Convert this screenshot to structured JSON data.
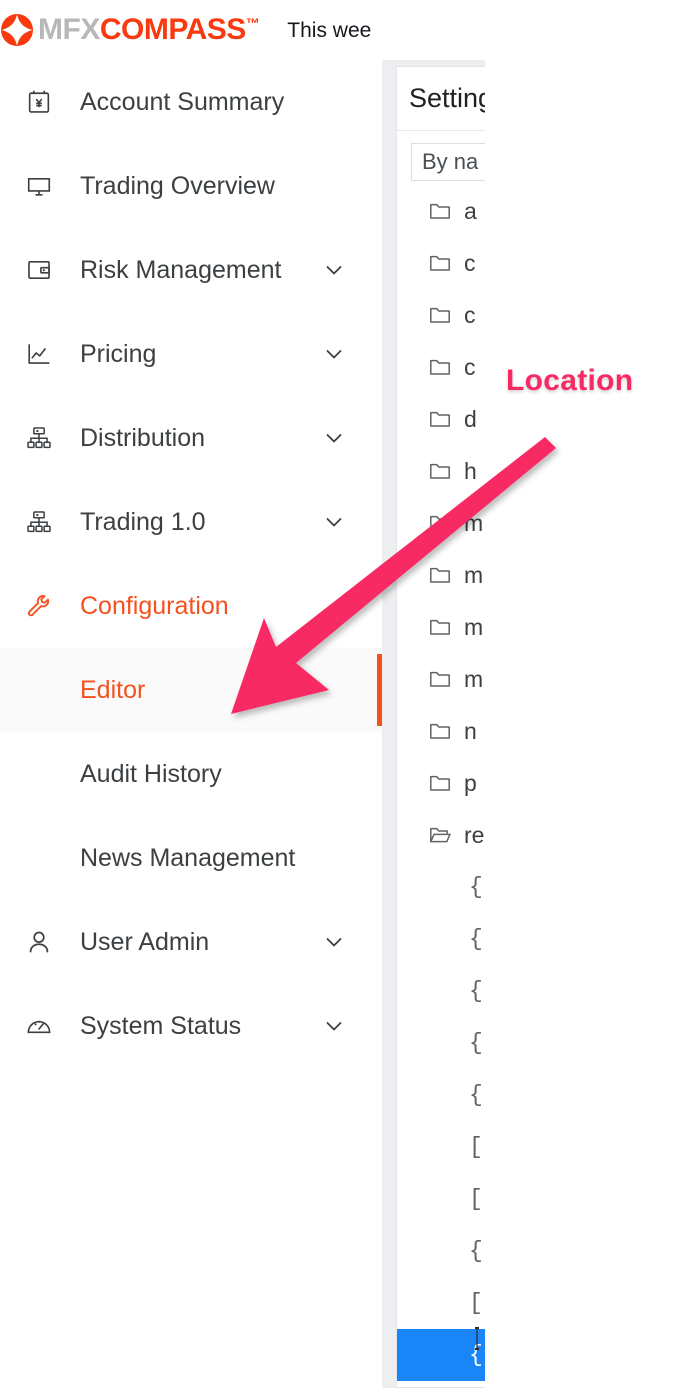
{
  "header": {
    "logo_mark": "diamond-star-icon",
    "logo_text_primary": "MFX",
    "logo_text_secondary": "COMPASS",
    "logo_trademark": "™",
    "note_text": "This wee",
    "brand_gray": "#b8b8b8",
    "brand_orange": "#f93a0f"
  },
  "sidebar": {
    "items": [
      {
        "label": "Account Summary",
        "icon": "calendar-yen-icon",
        "has_chevron": false,
        "level": 0,
        "state": "default"
      },
      {
        "label": "Trading Overview",
        "icon": "monitor-icon",
        "has_chevron": false,
        "level": 0,
        "state": "default"
      },
      {
        "label": "Risk Management",
        "icon": "wallet-icon",
        "has_chevron": true,
        "level": 0,
        "state": "default"
      },
      {
        "label": "Pricing",
        "icon": "line-chart-icon",
        "has_chevron": true,
        "level": 0,
        "state": "default"
      },
      {
        "label": "Distribution",
        "icon": "sitemap-icon",
        "has_chevron": true,
        "level": 0,
        "state": "default"
      },
      {
        "label": "Trading 1.0",
        "icon": "sitemap-icon",
        "has_chevron": true,
        "level": 0,
        "state": "default"
      },
      {
        "label": "Configuration",
        "icon": "wrench-icon",
        "has_chevron": false,
        "level": 0,
        "state": "accent"
      },
      {
        "label": "Editor",
        "icon": "none",
        "has_chevron": false,
        "level": 1,
        "state": "active"
      },
      {
        "label": "Audit History",
        "icon": "none",
        "has_chevron": false,
        "level": 1,
        "state": "default"
      },
      {
        "label": "News Management",
        "icon": "none",
        "has_chevron": false,
        "level": 1,
        "state": "default"
      },
      {
        "label": "User Admin",
        "icon": "person-icon",
        "has_chevron": true,
        "level": 0,
        "state": "default"
      },
      {
        "label": "System Status",
        "icon": "gauge-icon",
        "has_chevron": true,
        "level": 0,
        "state": "default"
      }
    ],
    "active_accent_color": "#f4511e",
    "active_row_background": "#fafafa"
  },
  "panel": {
    "title": "Setting",
    "search": {
      "value": "By na",
      "placeholder": "By na"
    },
    "tree": [
      {
        "name": "a",
        "icon": "folder-closed-icon",
        "depth": 1,
        "selected": false
      },
      {
        "name": "c",
        "icon": "folder-closed-icon",
        "depth": 1,
        "selected": false
      },
      {
        "name": "c",
        "icon": "folder-closed-icon",
        "depth": 1,
        "selected": false
      },
      {
        "name": "c",
        "icon": "folder-closed-icon",
        "depth": 1,
        "selected": false
      },
      {
        "name": "d",
        "icon": "folder-closed-icon",
        "depth": 1,
        "selected": false
      },
      {
        "name": "h",
        "icon": "folder-closed-icon",
        "depth": 1,
        "selected": false
      },
      {
        "name": "m",
        "icon": "folder-closed-icon",
        "depth": 1,
        "selected": false
      },
      {
        "name": "m",
        "icon": "folder-closed-icon",
        "depth": 1,
        "selected": false
      },
      {
        "name": "m",
        "icon": "folder-closed-icon",
        "depth": 1,
        "selected": false
      },
      {
        "name": "m",
        "icon": "folder-closed-icon",
        "depth": 1,
        "selected": false
      },
      {
        "name": "n",
        "icon": "folder-closed-icon",
        "depth": 1,
        "selected": false
      },
      {
        "name": "p",
        "icon": "folder-closed-icon",
        "depth": 1,
        "selected": false
      },
      {
        "name": "re",
        "icon": "folder-open-icon",
        "depth": 1,
        "selected": false
      },
      {
        "name": "{",
        "icon": "json-object-icon",
        "depth": 2,
        "selected": false
      },
      {
        "name": "{",
        "icon": "json-object-icon",
        "depth": 2,
        "selected": false
      },
      {
        "name": "{",
        "icon": "json-object-icon",
        "depth": 2,
        "selected": false
      },
      {
        "name": "{",
        "icon": "json-object-icon",
        "depth": 2,
        "selected": false
      },
      {
        "name": "{",
        "icon": "json-object-icon",
        "depth": 2,
        "selected": false
      },
      {
        "name": "[",
        "icon": "json-array-icon",
        "depth": 2,
        "selected": false
      },
      {
        "name": "[",
        "icon": "json-array-icon",
        "depth": 2,
        "selected": false
      },
      {
        "name": "{",
        "icon": "json-object-icon",
        "depth": 2,
        "selected": false
      },
      {
        "name": "[",
        "icon": "json-array-icon",
        "depth": 2,
        "selected": false
      },
      {
        "name": "{",
        "icon": "json-object-icon",
        "depth": 2,
        "selected": true
      }
    ],
    "selection_color": "#1a85f7"
  },
  "annotation": {
    "label": "Location",
    "color": "#f72b64",
    "outline_color": "#ffffff",
    "arrow": "arrow-pointing-down-left"
  }
}
